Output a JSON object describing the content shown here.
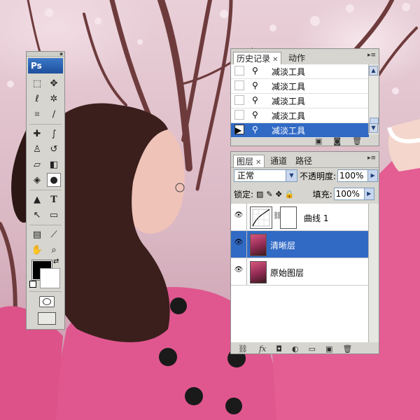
{
  "toolbox": {
    "logo": "Ps",
    "tools": [
      {
        "name": "rect-marquee-tool",
        "glyph": "⬚"
      },
      {
        "name": "move-tool",
        "glyph": "✥"
      },
      {
        "name": "lasso-tool",
        "glyph": "ℓ"
      },
      {
        "name": "magic-wand-tool",
        "glyph": "✲"
      },
      {
        "name": "crop-tool",
        "glyph": "⌗"
      },
      {
        "name": "slice-tool",
        "glyph": "∕"
      },
      {
        "name": "healing-brush-tool",
        "glyph": "✚"
      },
      {
        "name": "brush-tool",
        "glyph": "∫"
      },
      {
        "name": "clone-stamp-tool",
        "glyph": "♙"
      },
      {
        "name": "history-brush-tool",
        "glyph": "↺"
      },
      {
        "name": "eraser-tool",
        "glyph": "▱"
      },
      {
        "name": "paint-bucket-tool",
        "glyph": "◧"
      },
      {
        "name": "blur-tool",
        "glyph": "◈"
      },
      {
        "name": "burn-tool",
        "glyph": "●"
      },
      {
        "name": "path-select-tool",
        "glyph": "▲"
      },
      {
        "name": "type-tool",
        "glyph": "T"
      },
      {
        "name": "direct-select-tool",
        "glyph": "↖"
      },
      {
        "name": "shape-tool",
        "glyph": "▭"
      },
      {
        "name": "notes-tool",
        "glyph": "▤"
      },
      {
        "name": "eyedropper-tool",
        "glyph": "⟋"
      },
      {
        "name": "hand-tool",
        "glyph": "✋"
      },
      {
        "name": "zoom-tool",
        "glyph": "⌕"
      }
    ],
    "selected_tool": "burn-tool",
    "foreground_color": "#000000",
    "background_color": "#ffffff"
  },
  "history_panel": {
    "tabs": [
      "历史记录",
      "动作"
    ],
    "active_tab": "历史记录",
    "items": [
      "减淡工具",
      "减淡工具",
      "减淡工具",
      "减淡工具",
      "减淡工具"
    ],
    "selected_index": 4
  },
  "layers_panel": {
    "tabs": [
      "图层",
      "通道",
      "路径"
    ],
    "active_tab": "图层",
    "blend_mode": "正常",
    "opacity_label": "不透明度:",
    "opacity_value": "100%",
    "lock_label": "锁定:",
    "fill_label": "填充:",
    "fill_value": "100%",
    "layers": [
      {
        "name": "曲线 1",
        "type": "adjustment",
        "visible": true,
        "selected": false
      },
      {
        "name": "清晰层",
        "type": "pixel",
        "visible": true,
        "selected": true
      },
      {
        "name": "原始图层",
        "type": "pixel",
        "visible": true,
        "selected": false
      }
    ]
  },
  "colors": {
    "selection": "#316ac5",
    "panel_bg": "#d6d5cf"
  }
}
